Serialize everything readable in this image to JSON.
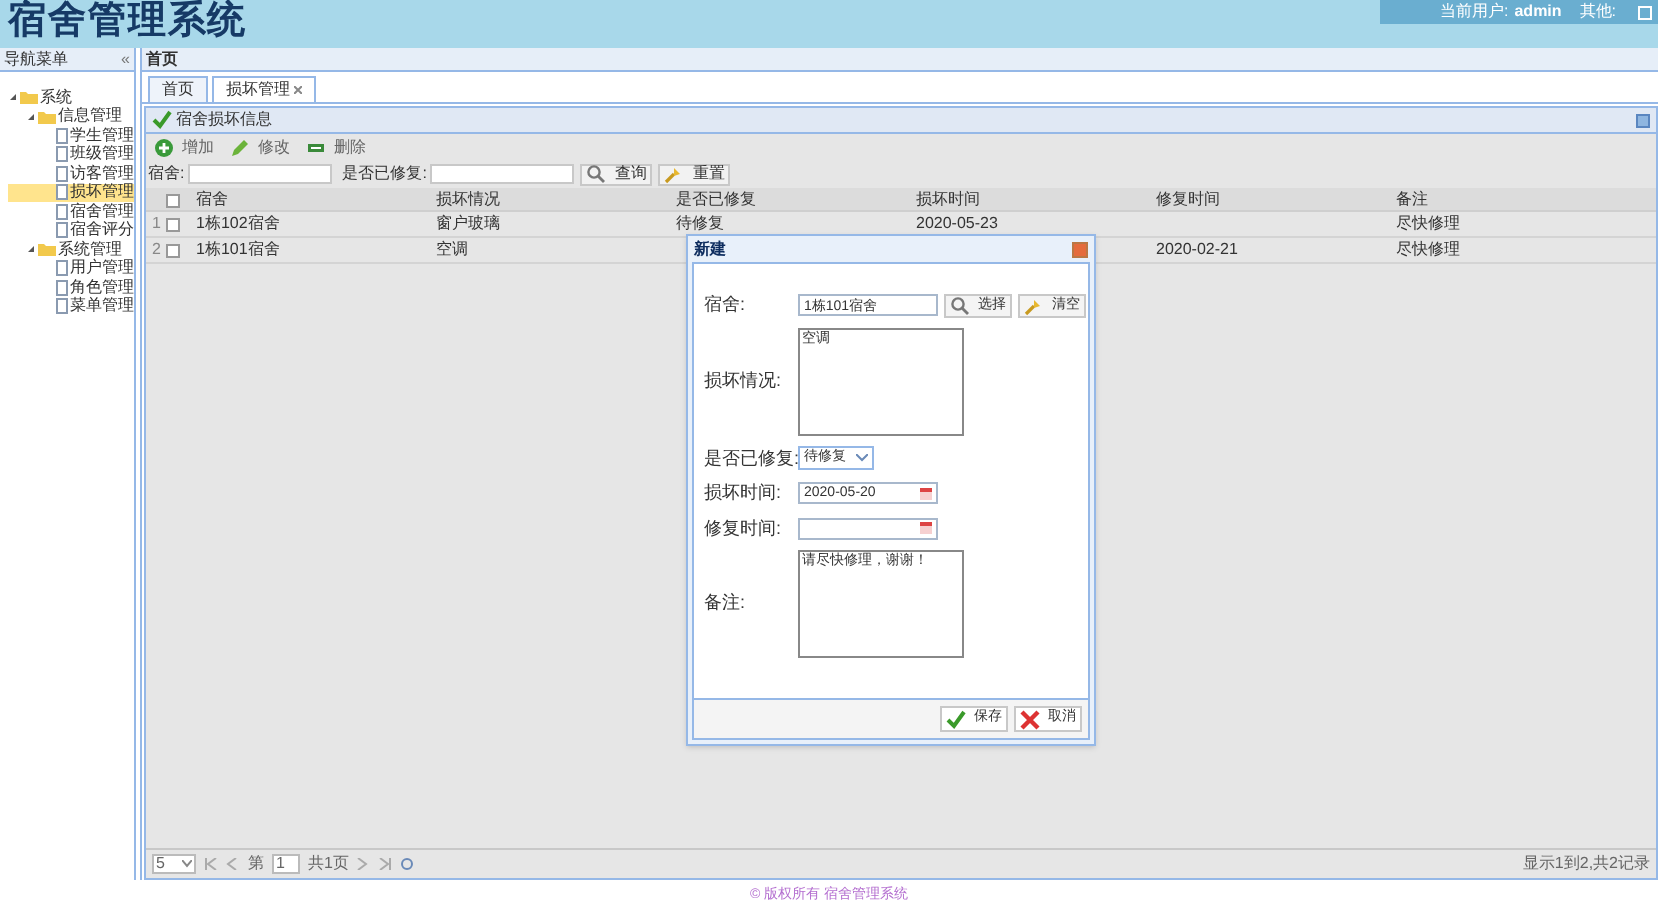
{
  "header": {
    "title": "宿舍管理系统",
    "user_label": "当前用户:",
    "user": "admin",
    "other": "其他:"
  },
  "sidebar": {
    "title": "导航菜单",
    "collapse": "«",
    "tree": [
      {
        "label": "系统",
        "expanded": true,
        "selected": false,
        "children": [
          {
            "label": "信息管理",
            "expanded": true,
            "selected": false,
            "children": [
              {
                "label": "学生管理",
                "selected": false
              },
              {
                "label": "班级管理",
                "selected": false
              },
              {
                "label": "访客管理",
                "selected": false
              },
              {
                "label": "损坏管理",
                "selected": true
              },
              {
                "label": "宿舍管理",
                "selected": false
              },
              {
                "label": "宿舍评分",
                "selected": false
              }
            ]
          },
          {
            "label": "系统管理",
            "expanded": true,
            "selected": false,
            "children": [
              {
                "label": "用户管理",
                "selected": false
              },
              {
                "label": "角色管理",
                "selected": false
              },
              {
                "label": "菜单管理",
                "selected": false
              }
            ]
          }
        ]
      }
    ]
  },
  "main": {
    "title": "首页",
    "tabs": [
      {
        "label": "首页",
        "selected": false,
        "closable": false
      },
      {
        "label": "损坏管理",
        "selected": true,
        "closable": true
      }
    ],
    "panel_title": "宿舍损坏信息",
    "toolbar": [
      {
        "kind": "add",
        "label": "增加"
      },
      {
        "kind": "edit",
        "label": "修改"
      },
      {
        "kind": "delete",
        "label": "删除"
      }
    ],
    "search": {
      "fields": [
        {
          "label": "宿舍:"
        },
        {
          "label": "是否已修复:"
        }
      ],
      "buttons": [
        {
          "kind": "search",
          "label": "查询"
        },
        {
          "kind": "reset",
          "label": "重置"
        }
      ]
    },
    "table": {
      "all_checked": false,
      "columns": [
        "宿舍",
        "损坏情况",
        "是否已修复",
        "损坏时间",
        "修复时间",
        "备注"
      ],
      "rows": [
        {
          "index": "1",
          "checked": false,
          "cells": [
            "1栋102宿舍",
            "窗户玻璃",
            "待修复",
            "2020-05-23",
            "",
            "尽快修理"
          ]
        },
        {
          "index": "2",
          "checked": false,
          "cells": [
            "1栋101宿舍",
            "空调",
            "",
            "",
            "2020-02-21",
            "尽快修理"
          ]
        }
      ]
    },
    "pager": {
      "page_size": "5",
      "page_label": "第",
      "page": "1",
      "total_pages": "共1页",
      "summary": "显示1到2,共2记录"
    }
  },
  "dialog": {
    "title": "新建",
    "dorm": {
      "label": "宿舍:",
      "value": "1栋101宿舍",
      "buttons": [
        {
          "kind": "search",
          "label": "选择"
        },
        {
          "kind": "reset",
          "label": "清空"
        }
      ]
    },
    "damage": {
      "label": "损坏情况:",
      "value": "空调"
    },
    "repaired": {
      "label": "是否已修复:",
      "value": "待修复"
    },
    "damage_time": {
      "label": "损坏时间:",
      "value": "2020-05-20"
    },
    "repair_time": {
      "label": "修复时间:"
    },
    "remark": {
      "label": "备注:",
      "value": "请尽快修理，谢谢！"
    },
    "buttons": [
      {
        "kind": "save",
        "label": "保存"
      },
      {
        "kind": "cancel",
        "label": "取消"
      }
    ]
  },
  "footer": "© 版权所有 宿舍管理系统"
}
